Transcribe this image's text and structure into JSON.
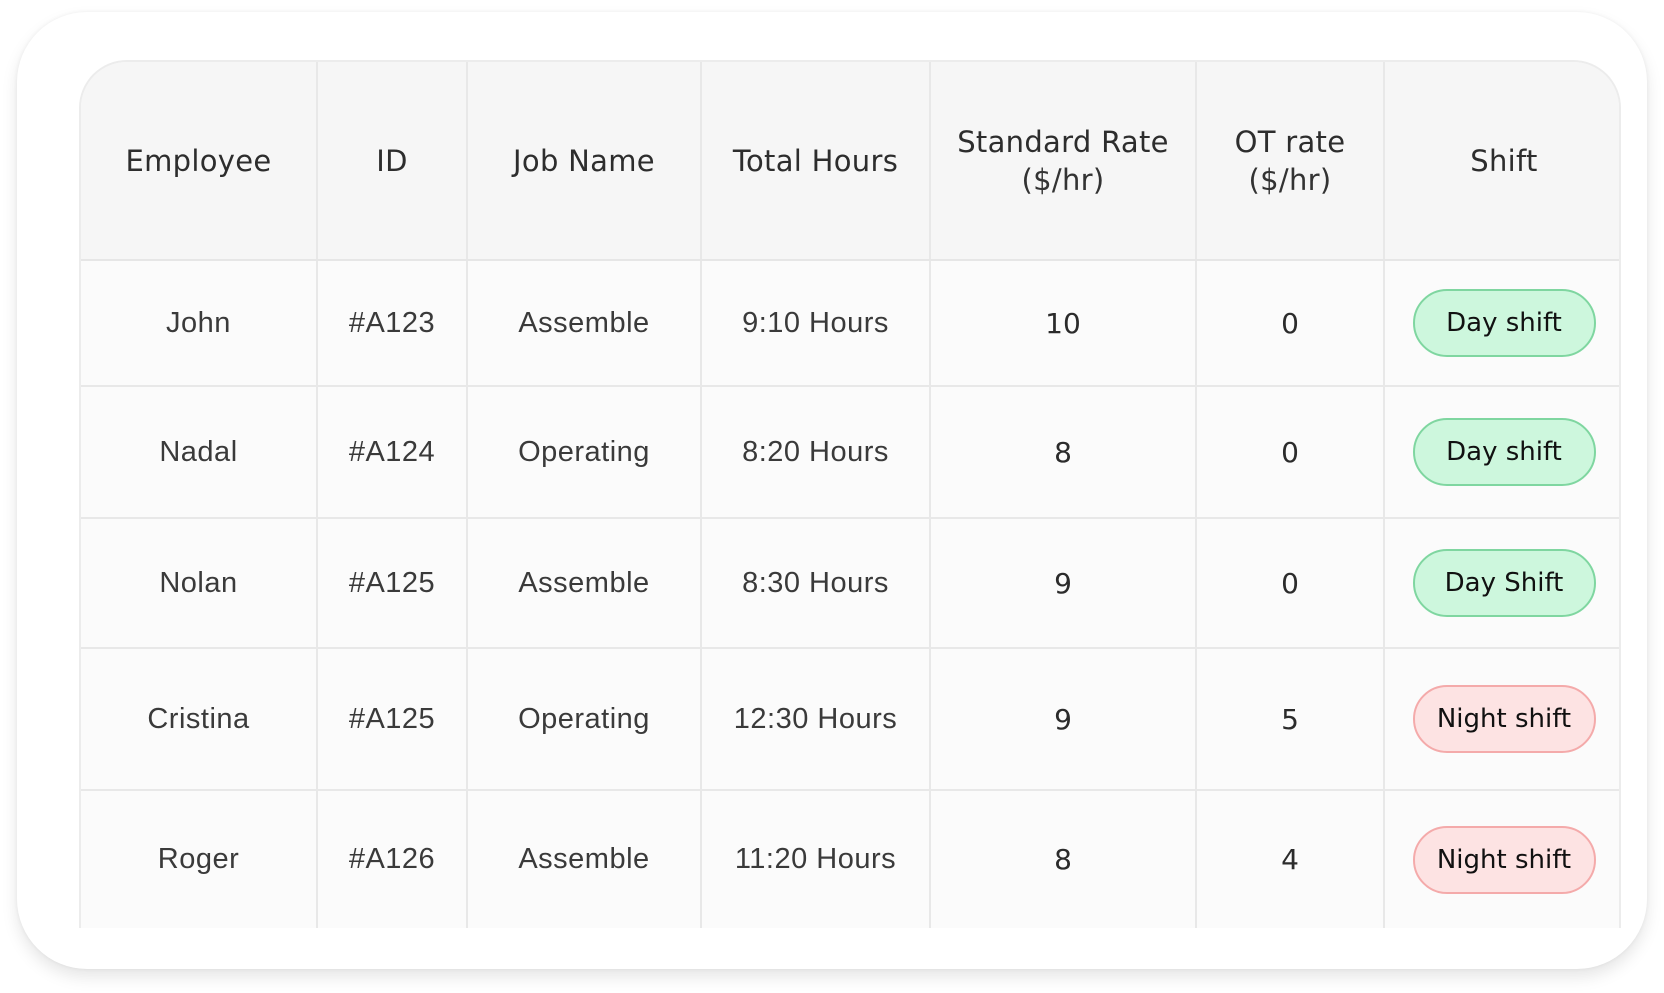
{
  "table": {
    "columns": [
      {
        "label": "Employee",
        "sub": ""
      },
      {
        "label": "ID",
        "sub": ""
      },
      {
        "label": "Job Name",
        "sub": ""
      },
      {
        "label": "Total Hours",
        "sub": ""
      },
      {
        "label": "Standard Rate",
        "sub": "($/hr)"
      },
      {
        "label": "OT rate",
        "sub": "($/hr)"
      },
      {
        "label": "Shift",
        "sub": ""
      }
    ],
    "rows": [
      {
        "employee": "John",
        "id": "#A123",
        "job": "Assemble",
        "hours": "9:10 Hours",
        "standard_rate": "10",
        "ot_rate": "0",
        "shift": "Day shift",
        "shift_type": "day"
      },
      {
        "employee": "Nadal",
        "id": "#A124",
        "job": "Operating",
        "hours": "8:20 Hours",
        "standard_rate": "8",
        "ot_rate": "0",
        "shift": "Day shift",
        "shift_type": "day"
      },
      {
        "employee": "Nolan",
        "id": "#A125",
        "job": "Assemble",
        "hours": "8:30 Hours",
        "standard_rate": "9",
        "ot_rate": "0",
        "shift": "Day Shift",
        "shift_type": "day"
      },
      {
        "employee": "Cristina",
        "id": "#A125",
        "job": "Operating",
        "hours": "12:30 Hours",
        "standard_rate": "9",
        "ot_rate": "5",
        "shift": "Night shift",
        "shift_type": "night"
      },
      {
        "employee": "Roger",
        "id": "#A126",
        "job": "Assemble",
        "hours": "11:20 Hours",
        "standard_rate": "8",
        "ot_rate": "4",
        "shift": "Night shift",
        "shift_type": "night"
      }
    ]
  },
  "colors": {
    "day_badge_bg": "#cdf7dd",
    "day_badge_border": "#7fd6a0",
    "night_badge_bg": "#fde3e3",
    "night_badge_border": "#f4aaaa",
    "header_bg": "#f6f6f6"
  }
}
